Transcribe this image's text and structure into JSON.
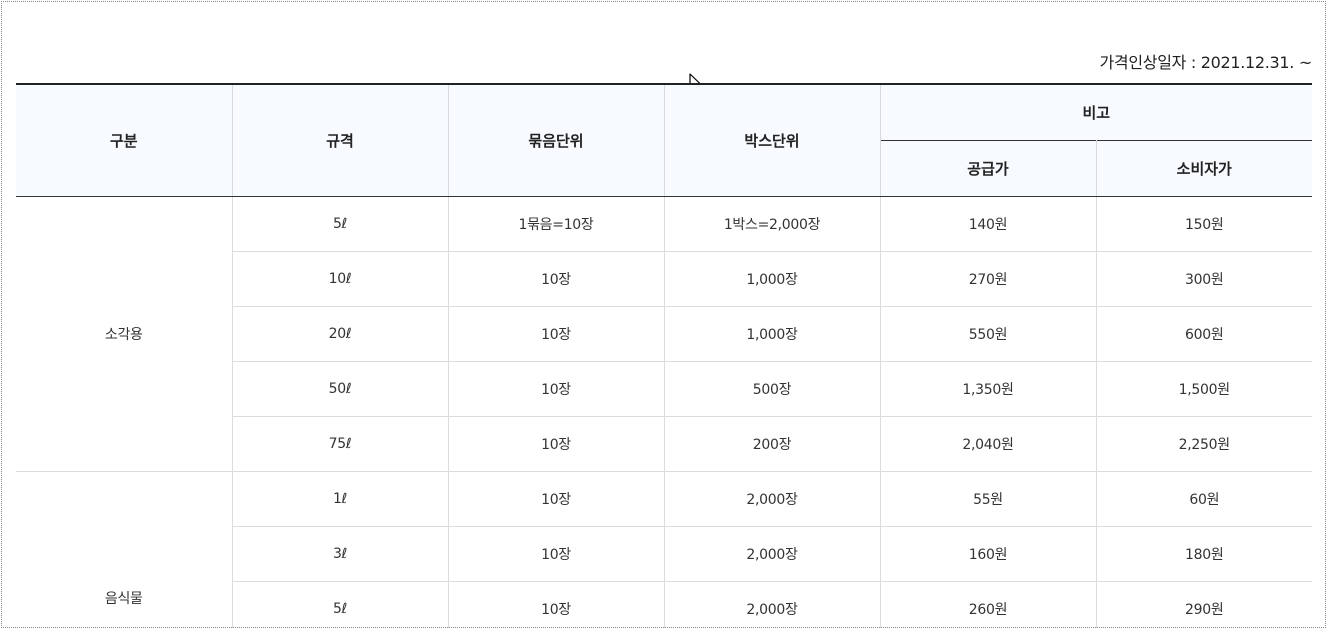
{
  "price_date": "가격인상일자 : 2021.12.31. ~",
  "headers": {
    "category": "구분",
    "spec": "규격",
    "bundle_unit": "묶음단위",
    "box_unit": "박스단위",
    "remarks": "비고",
    "supply_price": "공급가",
    "consumer_price": "소비자가"
  },
  "groups": [
    {
      "name": "소각용",
      "rows": [
        {
          "spec": "5ℓ",
          "bundle": "1묶음=10장",
          "box": "1박스=2,000장",
          "supply": "140원",
          "consumer": "150원"
        },
        {
          "spec": "10ℓ",
          "bundle": "10장",
          "box": "1,000장",
          "supply": "270원",
          "consumer": "300원"
        },
        {
          "spec": "20ℓ",
          "bundle": "10장",
          "box": "1,000장",
          "supply": "550원",
          "consumer": "600원"
        },
        {
          "spec": "50ℓ",
          "bundle": "10장",
          "box": "500장",
          "supply": "1,350원",
          "consumer": "1,500원"
        },
        {
          "spec": "75ℓ",
          "bundle": "10장",
          "box": "200장",
          "supply": "2,040원",
          "consumer": "2,250원"
        }
      ]
    },
    {
      "name": "음식물",
      "rows": [
        {
          "spec": "1ℓ",
          "bundle": "10장",
          "box": "2,000장",
          "supply": "55원",
          "consumer": "60원"
        },
        {
          "spec": "3ℓ",
          "bundle": "10장",
          "box": "2,000장",
          "supply": "160원",
          "consumer": "180원"
        },
        {
          "spec": "5ℓ",
          "bundle": "10장",
          "box": "2,000장",
          "supply": "260원",
          "consumer": "290원"
        }
      ]
    }
  ]
}
